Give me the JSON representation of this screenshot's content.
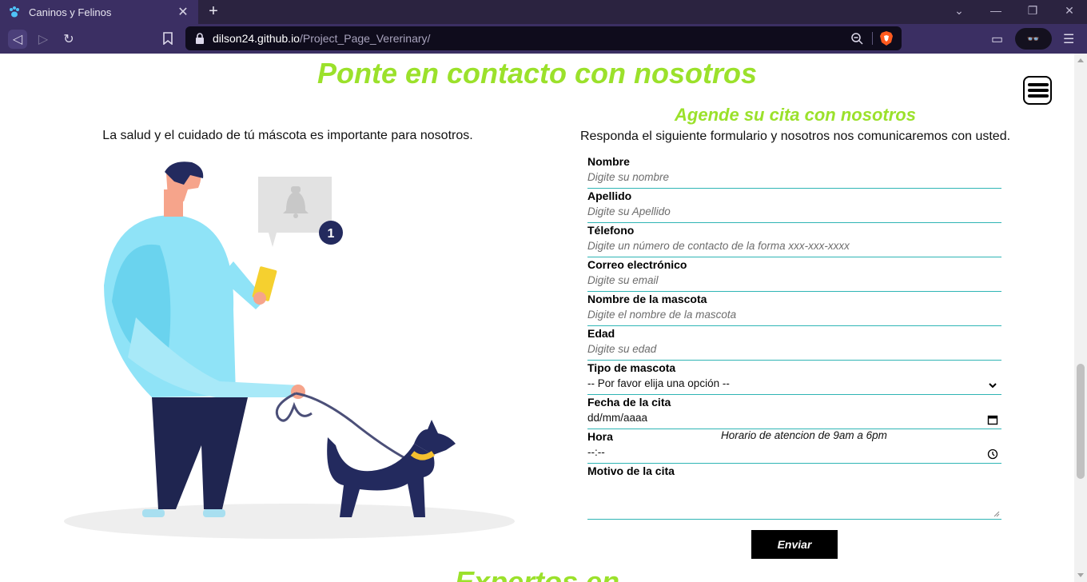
{
  "browser": {
    "tab_title": "Caninos y Felinos",
    "tab_close": "✕",
    "new_tab": "+",
    "url_host": "dilson24.github.io",
    "url_path": "/Project_Page_Vererinary/",
    "wallet_glyph": "👓",
    "controls": [
      "⌄",
      "—",
      "❐",
      "✕"
    ],
    "nav": [
      "◁",
      "▷",
      "↻"
    ],
    "right_icons": [
      "▭",
      "☰"
    ],
    "bookmark_icon": "bookmark-icon"
  },
  "header": {
    "title": "Ponte en contacto con nosotros",
    "menu_icon": "hamburger-menu-icon"
  },
  "left": {
    "text": "La salud y el cuidado de tú máscota es importante para nosotros.",
    "illustration": "man-walking-dog-illustration",
    "notification_count": "1"
  },
  "form": {
    "title": "Agende su cita con nosotros",
    "subtitle": "Responda el siguiente formulario y nosotros nos comunicaremos con usted.",
    "fields": [
      {
        "label": "Nombre",
        "placeholder": "Digite su nombre"
      },
      {
        "label": "Apellido",
        "placeholder": "Digite su Apellido"
      },
      {
        "label": "Télefono",
        "placeholder": "Digite un número de contacto de la forma xxx-xxx-xxxx"
      },
      {
        "label": "Correo electrónico",
        "placeholder": "Digite su email"
      },
      {
        "label": "Nombre de la mascota",
        "placeholder": "Digite el nombre de la mascota"
      },
      {
        "label": "Edad",
        "placeholder": "Digite su edad"
      }
    ],
    "pet_type": {
      "label": "Tipo de mascota",
      "value": "-- Por favor elija una opción --"
    },
    "date": {
      "label": "Fecha de la cita",
      "value": "dd/mm/aaaa"
    },
    "time": {
      "label": "Hora",
      "note": "Horario de atencion de 9am a 6pm",
      "value": "--:--"
    },
    "reason": {
      "label": "Motivo de la cita"
    },
    "submit": "Enviar"
  },
  "next_section_title": "Expertos en"
}
